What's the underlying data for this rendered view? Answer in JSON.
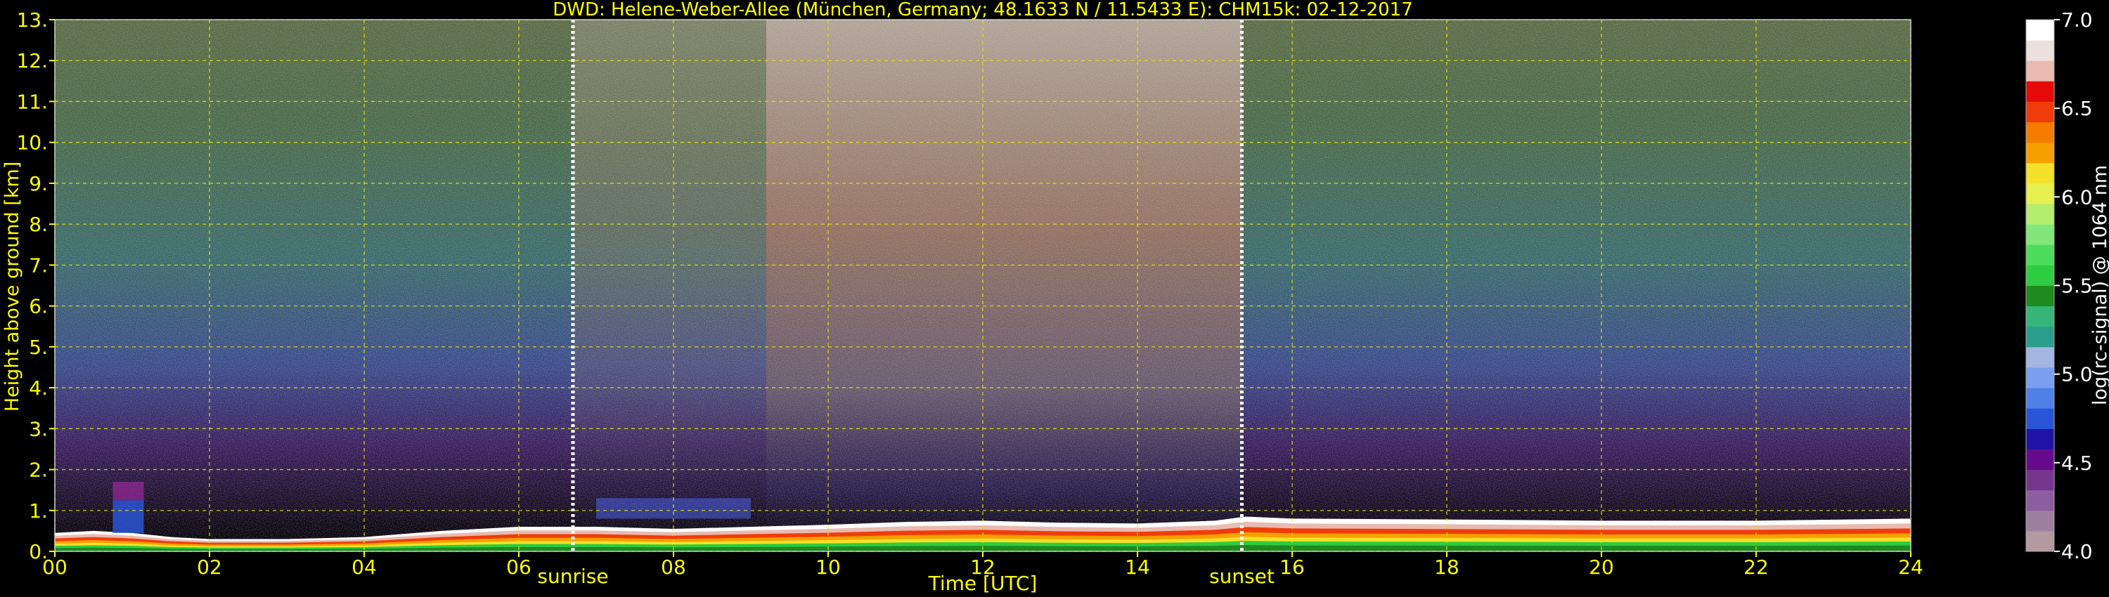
{
  "chart_data": {
    "type": "heatmap",
    "title": "DWD: Helene-Weber-Allee (München, Germany; 48.1633 N / 11.5433 E):    CHM15k: 02-12-2017",
    "xlabel": "Time [UTC]",
    "ylabel": "Height above ground [km]",
    "xlim": [
      0,
      24
    ],
    "ylim": [
      0,
      13
    ],
    "x_ticks": [
      0,
      2,
      4,
      6,
      8,
      10,
      12,
      14,
      16,
      18,
      20,
      22,
      24
    ],
    "x_tick_labels": [
      "00",
      "02",
      "04",
      "06",
      "08",
      "10",
      "12",
      "14",
      "16",
      "18",
      "20",
      "22",
      "24"
    ],
    "y_ticks": [
      0,
      1,
      2,
      3,
      4,
      5,
      6,
      7,
      8,
      9,
      10,
      11,
      12,
      13
    ],
    "y_tick_labels": [
      "0.",
      "1.",
      "2.",
      "3.",
      "4.",
      "5.",
      "6.",
      "7.",
      "8.",
      "9.",
      "10.",
      "11.",
      "12.",
      "13."
    ],
    "grid": true,
    "markers": [
      {
        "label": "sunrise",
        "time": 6.7
      },
      {
        "label": "sunset",
        "time": 15.35
      }
    ],
    "colorbar": {
      "label": "log(rc-signal) @ 1064 nm",
      "range": [
        4.0,
        7.0
      ],
      "ticks": [
        4.0,
        4.5,
        5.0,
        5.5,
        6.0,
        6.5,
        7.0
      ],
      "tick_labels": [
        "4.0",
        "4.5",
        "5.0",
        "5.5",
        "6.0",
        "6.5",
        "7.0"
      ],
      "colors": [
        "#b49aa0",
        "#9e7fa0",
        "#8c5ea0",
        "#76358f",
        "#660a8c",
        "#1f14a6",
        "#2a55d6",
        "#4f80e8",
        "#7a9ef0",
        "#a3b5e0",
        "#2a9e8a",
        "#35b578",
        "#1f8a1f",
        "#2ecc40",
        "#4cdc5c",
        "#80e67a",
        "#b4ee6e",
        "#e6f050",
        "#f5e12a",
        "#f5a000",
        "#f57c00",
        "#f03c0a",
        "#e60a0a",
        "#e8bab0",
        "#ece0dc",
        "#ffffff"
      ]
    },
    "boundary_layer": {
      "times": [
        0,
        0.5,
        1,
        1.5,
        2,
        3,
        4,
        5,
        6,
        7,
        8,
        9,
        10,
        11,
        12,
        13,
        14,
        15,
        15.4,
        16,
        18,
        20,
        22,
        24
      ],
      "heights": [
        0.45,
        0.5,
        0.45,
        0.35,
        0.3,
        0.3,
        0.35,
        0.5,
        0.6,
        0.6,
        0.55,
        0.6,
        0.65,
        0.72,
        0.75,
        0.7,
        0.68,
        0.75,
        0.85,
        0.8,
        0.78,
        0.75,
        0.75,
        0.8
      ]
    }
  }
}
